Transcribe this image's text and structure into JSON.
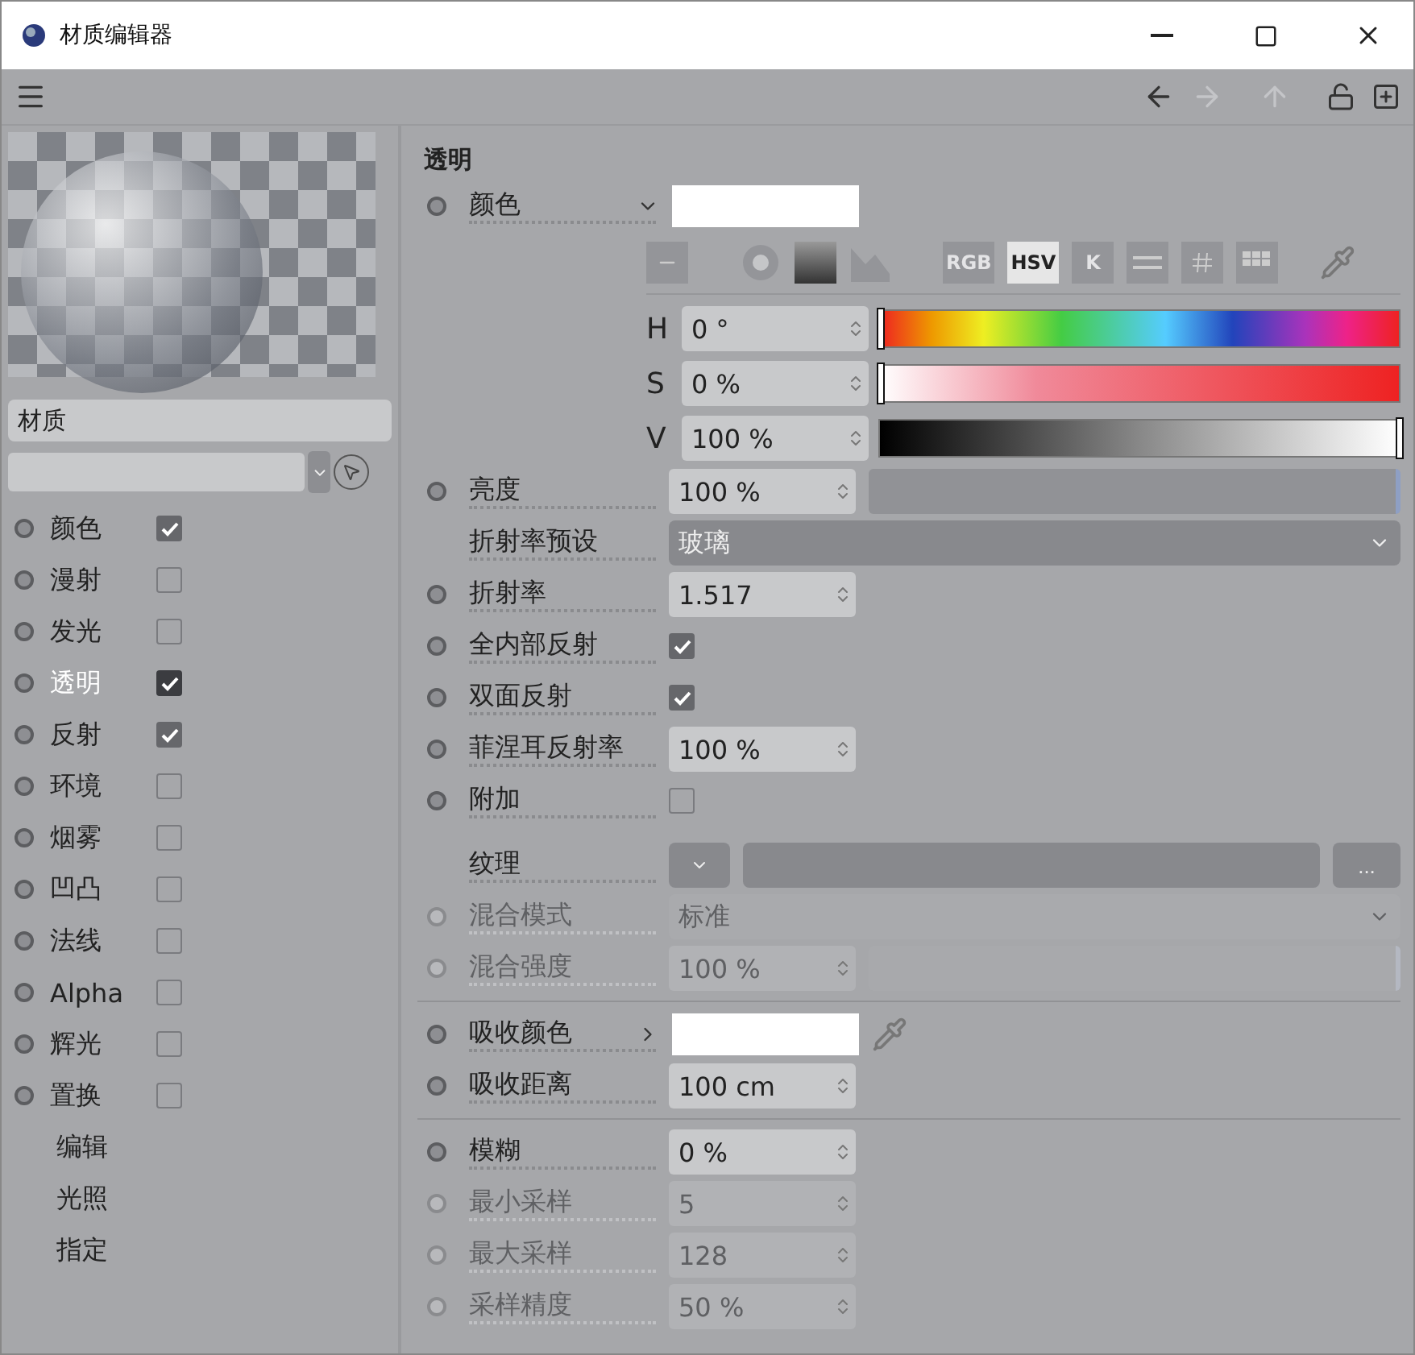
{
  "window": {
    "title": "材质编辑器"
  },
  "sidebar": {
    "name": "材质",
    "channels": [
      {
        "label": "颜色",
        "checked": true,
        "selected": false
      },
      {
        "label": "漫射",
        "checked": false,
        "selected": false
      },
      {
        "label": "发光",
        "checked": false,
        "selected": false
      },
      {
        "label": "透明",
        "checked": true,
        "selected": true
      },
      {
        "label": "反射",
        "checked": true,
        "selected": false
      },
      {
        "label": "环境",
        "checked": false,
        "selected": false
      },
      {
        "label": "烟雾",
        "checked": false,
        "selected": false
      },
      {
        "label": "凹凸",
        "checked": false,
        "selected": false
      },
      {
        "label": "法线",
        "checked": false,
        "selected": false
      },
      {
        "label": "Alpha",
        "checked": false,
        "selected": false
      },
      {
        "label": "辉光",
        "checked": false,
        "selected": false
      },
      {
        "label": "置换",
        "checked": false,
        "selected": false
      }
    ],
    "links": [
      "编辑",
      "光照",
      "指定"
    ]
  },
  "panel": {
    "title": "透明",
    "rows": [
      {
        "kind": "color",
        "label": "颜色",
        "expanded": true,
        "disabled": false
      },
      {
        "kind": "tools",
        "modes": [
          {
            "label": "RGB",
            "selected": false
          },
          {
            "label": "HSV",
            "selected": true
          },
          {
            "label": "K",
            "selected": false
          }
        ]
      },
      {
        "kind": "hsv",
        "channels": [
          {
            "label": "H",
            "value": "0 °",
            "level": 0,
            "kind": "hue"
          },
          {
            "label": "S",
            "value": "0 %",
            "level": 0,
            "kind": "sat"
          },
          {
            "label": "V",
            "value": "100 %",
            "level": 1,
            "kind": "val"
          }
        ]
      },
      {
        "kind": "number",
        "label": "亮度",
        "value": "100 %",
        "level": 1,
        "disabled": false
      },
      {
        "kind": "dropdown",
        "label": "折射率预设",
        "value": "玻璃",
        "disabled": false,
        "plain": true
      },
      {
        "kind": "number",
        "label": "折射率",
        "value": "1.517",
        "disabled": false
      },
      {
        "kind": "checkbox",
        "label": "全内部反射",
        "checked": true,
        "disabled": false
      },
      {
        "kind": "checkbox",
        "label": "双面反射",
        "checked": true,
        "disabled": false
      },
      {
        "kind": "number",
        "label": "菲涅耳反射率",
        "value": "100 %",
        "disabled": false
      },
      {
        "kind": "checkbox",
        "label": "附加",
        "checked": false,
        "disabled": false
      },
      {
        "kind": "texture",
        "label": "纹理",
        "browse": "...",
        "plain": true
      },
      {
        "kind": "dropdown",
        "label": "混合模式",
        "value": "标准",
        "disabled": true
      },
      {
        "kind": "number",
        "label": "混合强度",
        "value": "100 %",
        "level": 1,
        "disabled": true
      },
      {
        "kind": "separator"
      },
      {
        "kind": "color",
        "label": "吸收颜色",
        "expanded": false,
        "disabled": false
      },
      {
        "kind": "number",
        "label": "吸收距离",
        "value": "100 cm",
        "disabled": false
      },
      {
        "kind": "separator"
      },
      {
        "kind": "number",
        "label": "模糊",
        "value": "0 %",
        "disabled": false
      },
      {
        "kind": "number",
        "label": "最小采样",
        "value": "5",
        "disabled": true
      },
      {
        "kind": "number",
        "label": "最大采样",
        "value": "128",
        "disabled": true
      },
      {
        "kind": "number",
        "label": "采样精度",
        "value": "50 %",
        "disabled": true
      }
    ]
  }
}
